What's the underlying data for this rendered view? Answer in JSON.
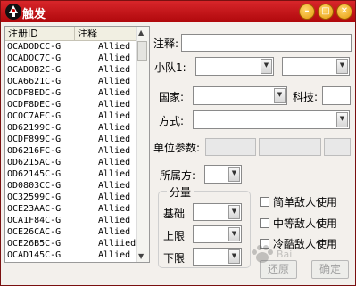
{
  "window": {
    "title": "触发",
    "controls": [
      "minimize-icon",
      "maximize-icon",
      "close-icon"
    ]
  },
  "list": {
    "columns": [
      "注册ID",
      "注释"
    ],
    "rows": [
      {
        "id": "OCADODCC-G",
        "note": "Allied"
      },
      {
        "id": "OCADOC7C-G",
        "note": "Allied"
      },
      {
        "id": "OCADOB2C-G",
        "note": "Allied"
      },
      {
        "id": "OCA6621C-G",
        "note": "Allied"
      },
      {
        "id": "OCDF8EDC-G",
        "note": "Allied"
      },
      {
        "id": "OCDF8DEC-G",
        "note": "Allied"
      },
      {
        "id": "OCOC7AEC-G",
        "note": "Allied"
      },
      {
        "id": "OD62199C-G",
        "note": "Allied"
      },
      {
        "id": "OCDF899C-G",
        "note": "Allied"
      },
      {
        "id": "OD6216FC-G",
        "note": "Allied"
      },
      {
        "id": "OD6215AC-G",
        "note": "Allied"
      },
      {
        "id": "OD62145C-G",
        "note": "Allied"
      },
      {
        "id": "OD0803CC-G",
        "note": "Allied"
      },
      {
        "id": "OC32599C-G",
        "note": "Allied"
      },
      {
        "id": "OCE23AAC-G",
        "note": "Allied"
      },
      {
        "id": "OCA1F84C-G",
        "note": "Allied"
      },
      {
        "id": "OCE26CAC-G",
        "note": "Allied"
      },
      {
        "id": "OCE26B5C-G",
        "note": "Alliied"
      },
      {
        "id": "OCAD145C-G",
        "note": "Allied"
      }
    ]
  },
  "form": {
    "note_label": "注释:",
    "note_value": "",
    "team_label": "小队1:",
    "team_value1": "",
    "team_value2": "",
    "country_label": "国家:",
    "country_value": "",
    "tech_label": "科技:",
    "tech_value": "",
    "mode_label": "方式:",
    "mode_value": "",
    "unit_param_label": "单位参数:",
    "owner_label": "所属方:",
    "owner_value": "",
    "weight_group_label": "分量",
    "base_label": "基础",
    "upper_label": "上限",
    "lower_label": "下限",
    "simple_enemy_label": "简单敌人使用",
    "medium_enemy_label": "中等敌人使用",
    "hard_enemy_label": "冷酷敌人使用",
    "restore_button": "还原",
    "ok_button": "确定"
  },
  "watermark": "Baidu 经验"
}
